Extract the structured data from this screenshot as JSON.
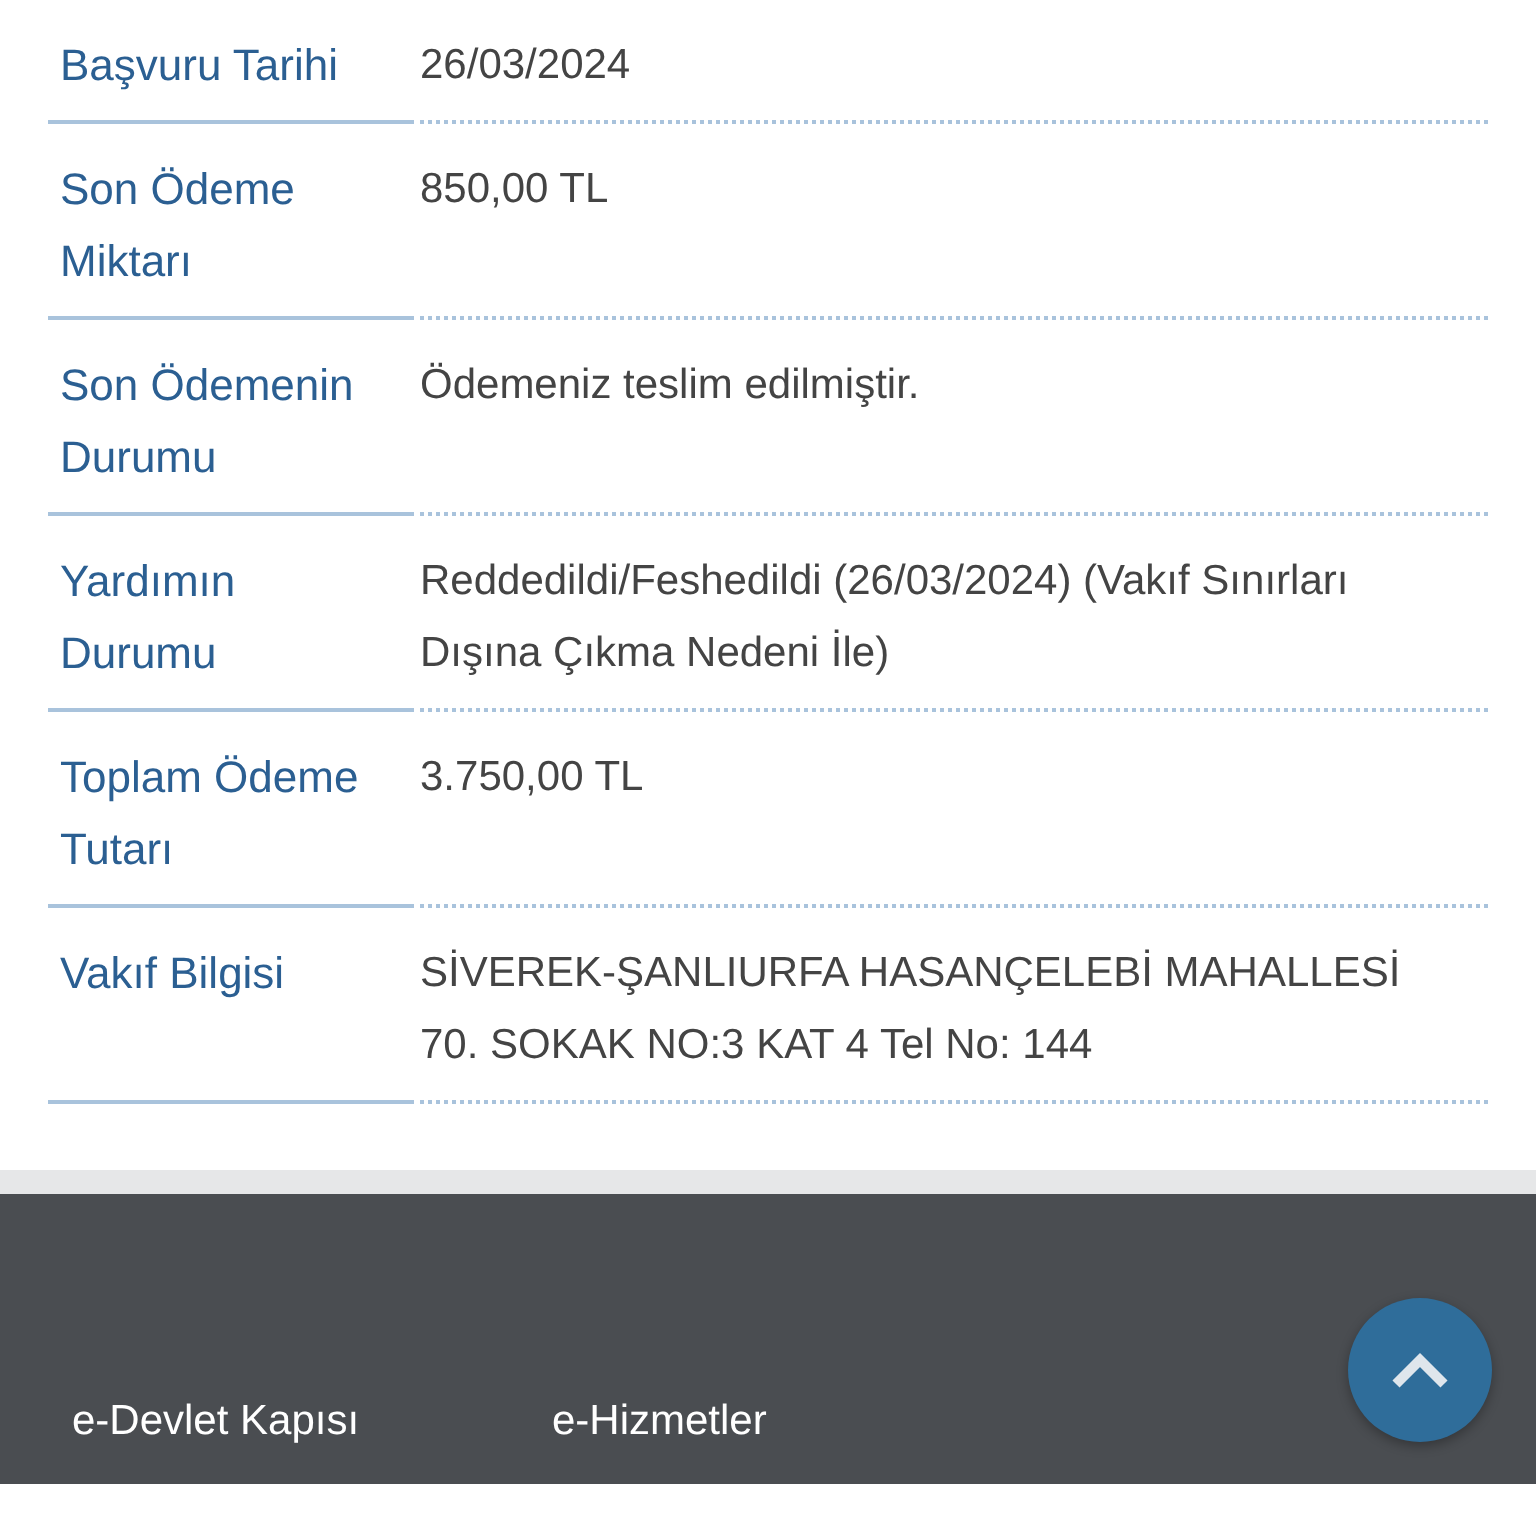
{
  "details": [
    {
      "label": "Başvuru Tarihi",
      "value": "26/03/2024"
    },
    {
      "label": "Son Ödeme Miktarı",
      "value": "850,00 TL"
    },
    {
      "label": "Son Ödemenin Durumu",
      "value": "Ödemeniz teslim edilmiştir."
    },
    {
      "label": "Yardımın Durumu",
      "value": "Reddedildi/Feshedildi (26/03/2024) (Vakıf Sınırları Dışına Çıkma Nedeni İle)"
    },
    {
      "label": "Toplam Ödeme Tutarı",
      "value": "3.750,00 TL"
    },
    {
      "label": "Vakıf Bilgisi",
      "value": "SİVEREK-ŞANLIURFA HASANÇELEBİ MAHALLESİ 70. SOKAK NO:3 KAT 4 Tel No: 144"
    }
  ],
  "footer": {
    "headings": [
      "e-Devlet Kapısı",
      "e-Hizmetler"
    ]
  }
}
